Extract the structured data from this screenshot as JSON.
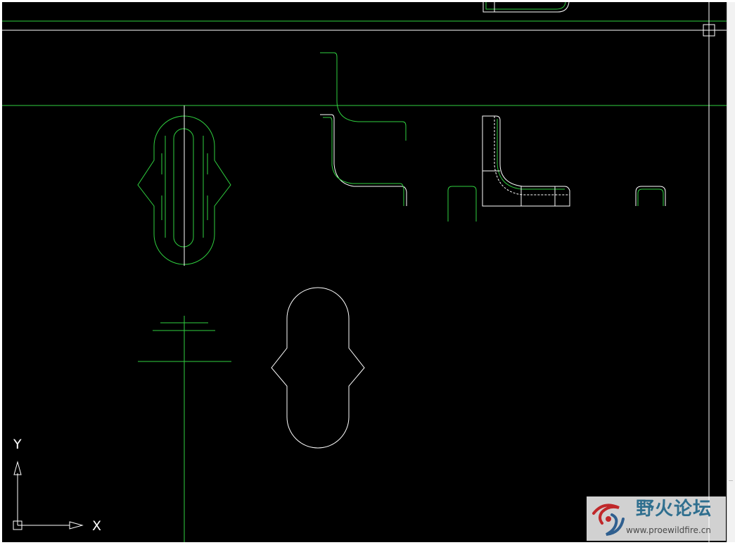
{
  "colors": {
    "background": "#000000",
    "frame": "#ffffff",
    "geometry_green": "#2fcf3f",
    "geometry_white": "#ffffff",
    "watermark_text": "#2f6f8f",
    "watermark_logo_red": "#c0282a",
    "watermark_logo_blue": "#2f5f8f"
  },
  "ucs_icon": {
    "x_label": "X",
    "y_label": "Y"
  },
  "watermark": {
    "title": "野火论坛",
    "url": "www.proewildfire.cn",
    "logo_icon": "swirl-logo-icon"
  },
  "crosshair": {
    "pickbox_icon": "pickbox-icon"
  }
}
